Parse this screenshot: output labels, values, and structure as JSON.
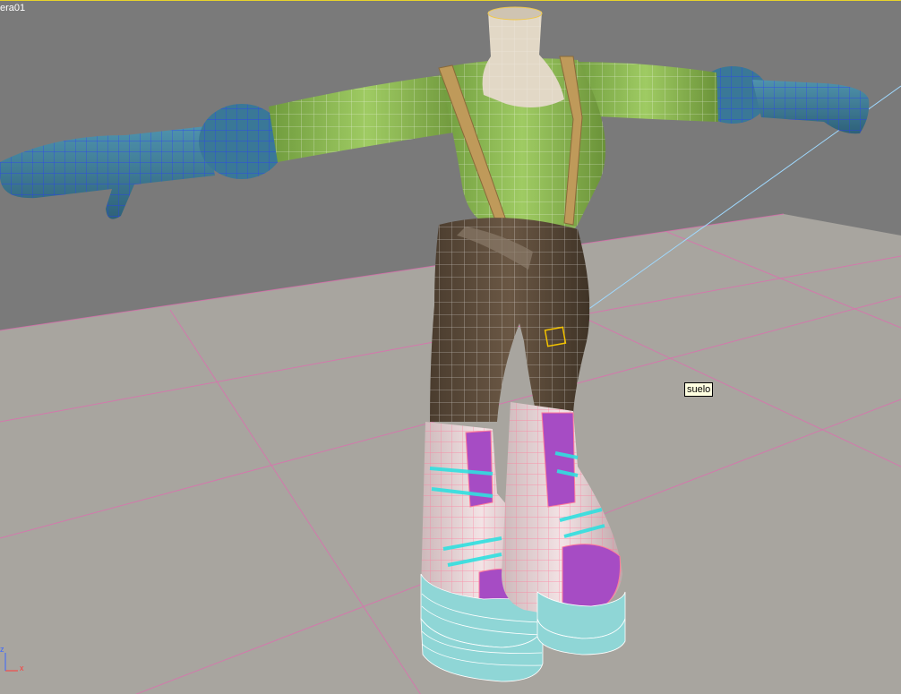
{
  "viewport": {
    "label": "era01",
    "border_color": "#e8d32a",
    "background_color": "#7a7a7a"
  },
  "scene": {
    "ground_color": "#a8a59f",
    "grid_color": "#e06bb0",
    "object_name_tooltip": "suelo",
    "model_colors": {
      "torso": "#8fb957",
      "hands": "#3e7e9a",
      "pants": "#5a4a3a",
      "boot_accent": "#a64cc4",
      "boot_body": "#e9d6d8",
      "boot_sole": "#8fd6d6",
      "straps": "#bf9a5a",
      "wire_white": "#ffffff",
      "wire_blue": "#2838ff",
      "wire_pink": "#ff7a9a",
      "wire_teal": "#30e0e0"
    }
  },
  "axis_tripod": {
    "z_label": "z",
    "x_label": "x",
    "z_color": "#3a66ff",
    "x_color": "#ff3a3a"
  }
}
